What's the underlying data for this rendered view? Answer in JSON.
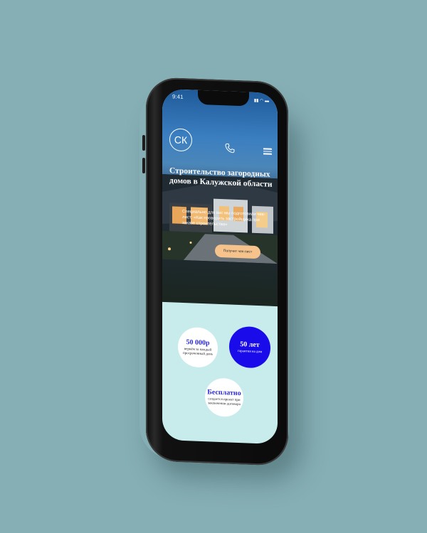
{
  "status_bar": {
    "time": "9:41"
  },
  "header": {
    "logo_text": "СК"
  },
  "hero": {
    "title": "Строительство загородных домов в Калужской области",
    "subtitle": "Специально для вас мы подготовили чек-лист: «Как проверить застройщика при заказе строительства»",
    "cta_label": "Получит чек-лист"
  },
  "features": [
    {
      "value": "50 000р",
      "desc": "вернём за каждый просроченный день"
    },
    {
      "value": "50 лет",
      "desc": "гарантия на дом"
    },
    {
      "value": "Бесплатно",
      "desc": "создается проект при заключении договора"
    }
  ],
  "colors": {
    "background": "#86afb5",
    "accent_blue": "#1a0cea",
    "cta": "#f5c38b",
    "lower_bg": "#c8ecec"
  },
  "icons": [
    "phone-icon",
    "menu-icon",
    "logo"
  ]
}
